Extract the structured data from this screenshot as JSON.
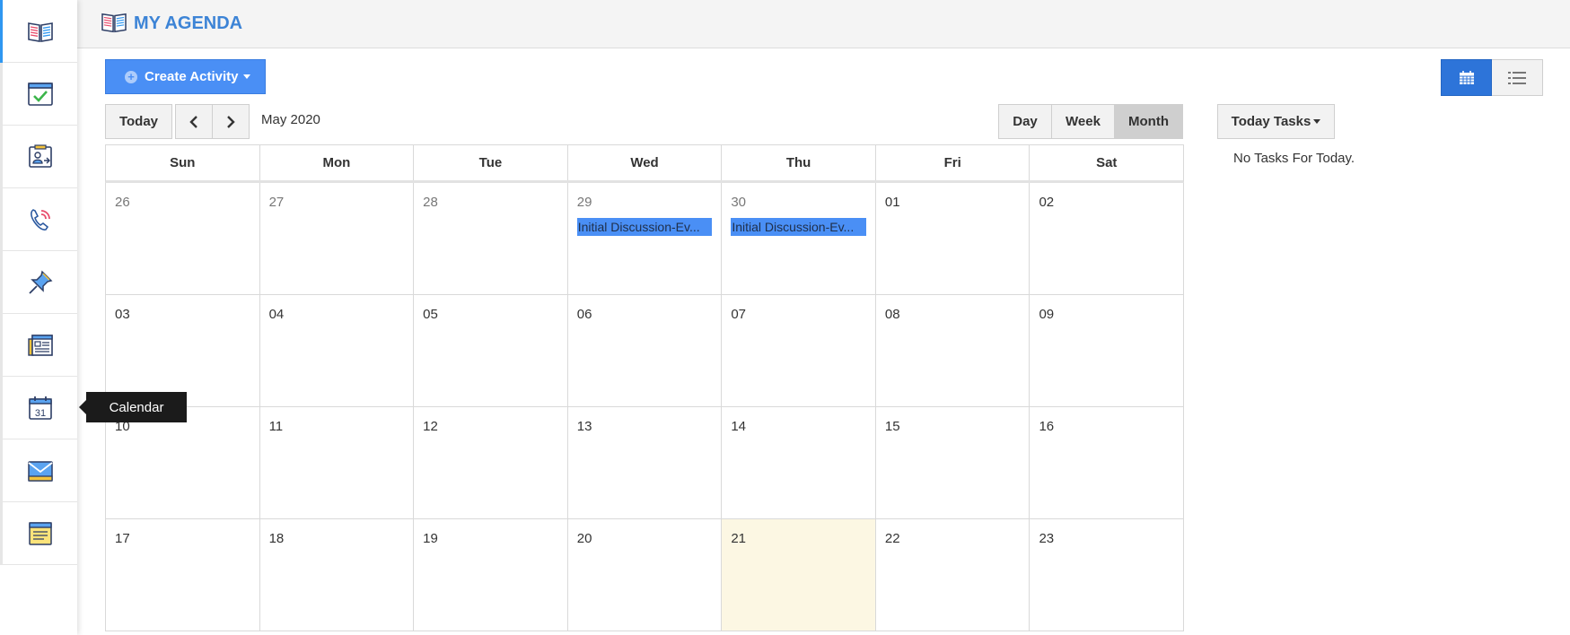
{
  "header": {
    "title": "MY AGENDA",
    "icon": "open-book-icon"
  },
  "sidebar": {
    "items": [
      {
        "name": "agenda",
        "icon": "open-book-icon",
        "active": true
      },
      {
        "name": "tasks",
        "icon": "task-check-icon"
      },
      {
        "name": "contacts",
        "icon": "contact-card-icon"
      },
      {
        "name": "calls",
        "icon": "phone-icon"
      },
      {
        "name": "pins",
        "icon": "pushpin-icon"
      },
      {
        "name": "news",
        "icon": "newspaper-icon"
      },
      {
        "name": "calendar",
        "icon": "calendar-icon",
        "hovered": true
      },
      {
        "name": "mail",
        "icon": "envelope-icon"
      },
      {
        "name": "notes",
        "icon": "notepad-icon"
      }
    ],
    "tooltip": "Calendar"
  },
  "toolbar": {
    "create_label": "Create Activity",
    "today_label": "Today",
    "month_label": "May 2020",
    "views": [
      "Day",
      "Week",
      "Month"
    ],
    "active_view": "Month"
  },
  "calendar": {
    "days_of_week": [
      "Sun",
      "Mon",
      "Tue",
      "Wed",
      "Thu",
      "Fri",
      "Sat"
    ],
    "weeks": [
      [
        {
          "num": "26",
          "other": true
        },
        {
          "num": "27",
          "other": true
        },
        {
          "num": "28",
          "other": true
        },
        {
          "num": "29",
          "other": true,
          "event": "Initial Discussion-Ev..."
        },
        {
          "num": "30",
          "other": true,
          "event": "Initial Discussion-Ev..."
        },
        {
          "num": "01"
        },
        {
          "num": "02"
        }
      ],
      [
        {
          "num": "03"
        },
        {
          "num": "04"
        },
        {
          "num": "05"
        },
        {
          "num": "06"
        },
        {
          "num": "07"
        },
        {
          "num": "08"
        },
        {
          "num": "09"
        }
      ],
      [
        {
          "num": "10"
        },
        {
          "num": "11"
        },
        {
          "num": "12"
        },
        {
          "num": "13"
        },
        {
          "num": "14"
        },
        {
          "num": "15"
        },
        {
          "num": "16"
        }
      ],
      [
        {
          "num": "17"
        },
        {
          "num": "18"
        },
        {
          "num": "19"
        },
        {
          "num": "20"
        },
        {
          "num": "21",
          "today": true
        },
        {
          "num": "22"
        },
        {
          "num": "23"
        }
      ]
    ]
  },
  "tasks": {
    "button_label": "Today Tasks",
    "empty_text": "No Tasks For Today."
  },
  "colors": {
    "accent_blue": "#4a8ff5",
    "title_blue": "#3d84d6",
    "today_bg": "#fcf7e3",
    "tooltip_bg": "#1b1b1b"
  }
}
